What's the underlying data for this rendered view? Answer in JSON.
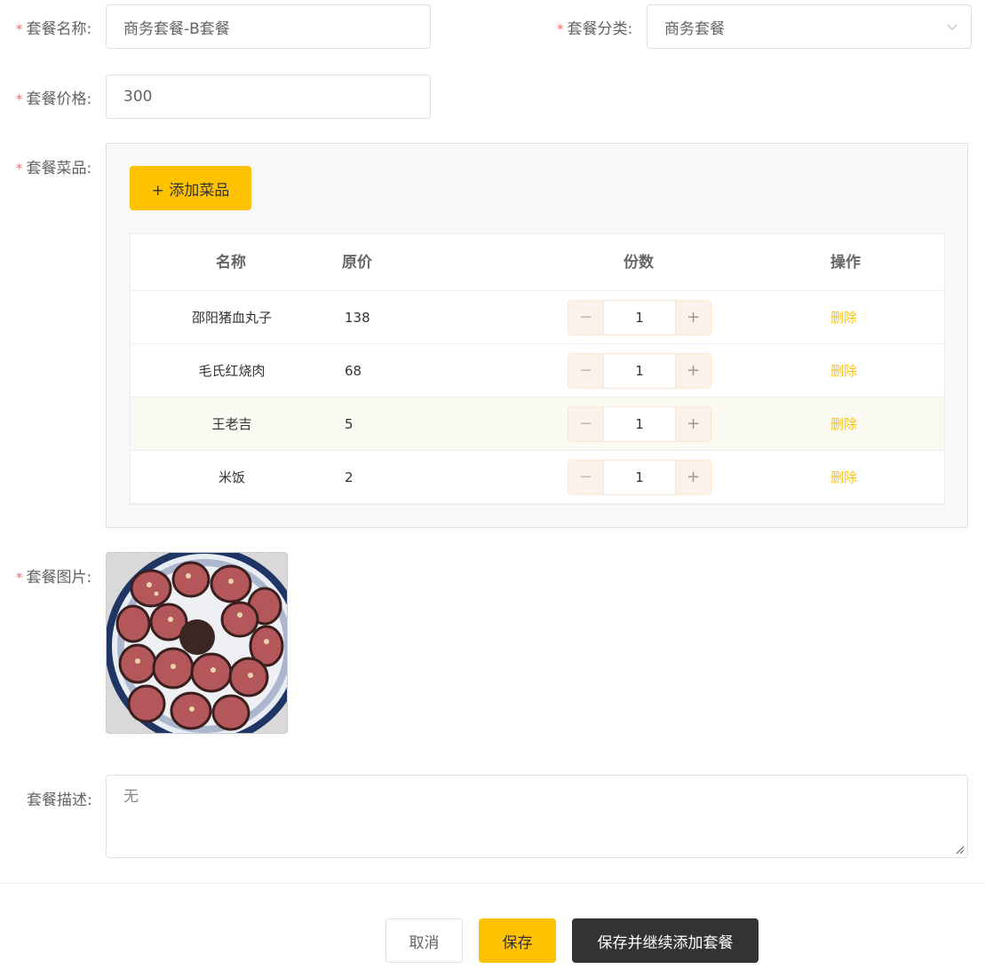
{
  "form": {
    "name": {
      "label": "套餐名称:",
      "value": "商务套餐-B套餐"
    },
    "category": {
      "label": "套餐分类:",
      "value": "商务套餐"
    },
    "price": {
      "label": "套餐价格:",
      "value": "300"
    },
    "dishes": {
      "label": "套餐菜品:"
    },
    "image": {
      "label": "套餐图片:"
    },
    "description": {
      "label": "套餐描述:",
      "value": "无"
    },
    "required_mark": "*"
  },
  "dish_table": {
    "add_button": "+ 添加菜品",
    "headers": {
      "name": "名称",
      "price": "原价",
      "quantity": "份数",
      "action": "操作"
    },
    "stepper_minus": "−",
    "stepper_plus": "+",
    "rows": [
      {
        "name": "邵阳猪血丸子",
        "price": "138",
        "quantity": "1",
        "action": "删除"
      },
      {
        "name": "毛氏红烧肉",
        "price": "68",
        "quantity": "1",
        "action": "删除"
      },
      {
        "name": "王老吉",
        "price": "5",
        "quantity": "1",
        "action": "删除"
      },
      {
        "name": "米饭",
        "price": "2",
        "quantity": "1",
        "action": "删除"
      }
    ]
  },
  "footer": {
    "cancel": "取消",
    "save": "保存",
    "save_continue": "保存并继续添加套餐"
  },
  "colors": {
    "accent": "#ffc200",
    "dark_button": "#333333",
    "required": "#f56c6c"
  }
}
